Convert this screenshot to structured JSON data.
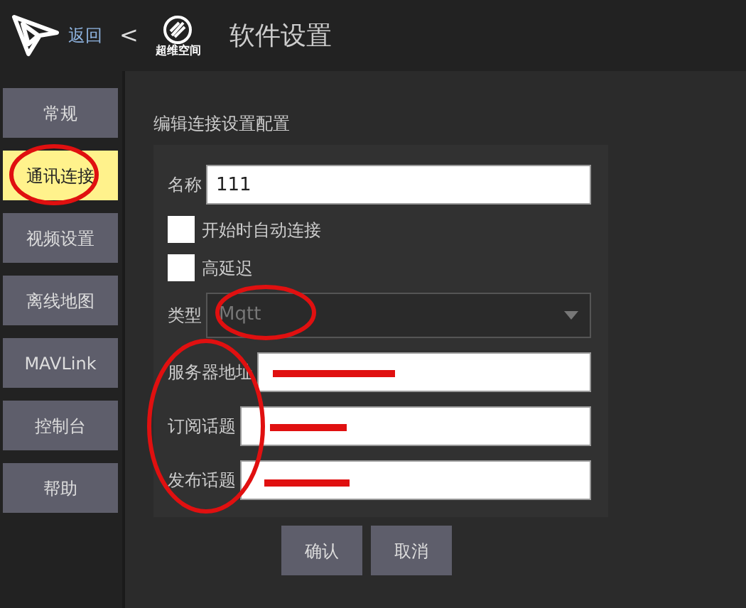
{
  "header": {
    "back_label": "返回",
    "separator": "<",
    "logo_text": "超维空间",
    "title": "软件设置"
  },
  "sidebar": {
    "items": [
      {
        "label": "常规",
        "selected": false
      },
      {
        "label": "通讯连接",
        "selected": true
      },
      {
        "label": "视频设置",
        "selected": false
      },
      {
        "label": "离线地图",
        "selected": false
      },
      {
        "label": "MAVLink",
        "selected": false
      },
      {
        "label": "控制台",
        "selected": false
      },
      {
        "label": "帮助",
        "selected": false
      }
    ]
  },
  "form": {
    "title": "编辑连接设置配置",
    "name": {
      "label": "名称",
      "value": "111"
    },
    "checkboxes": [
      {
        "label": "开始时自动连接",
        "checked": false
      },
      {
        "label": "高延迟",
        "checked": false
      }
    ],
    "type": {
      "label": "类型",
      "value": "Mqtt"
    },
    "fields": [
      {
        "label": "服务器地址"
      },
      {
        "label": "订阅话题"
      },
      {
        "label": "发布话题"
      }
    ],
    "buttons": [
      "确认",
      "取消"
    ]
  }
}
